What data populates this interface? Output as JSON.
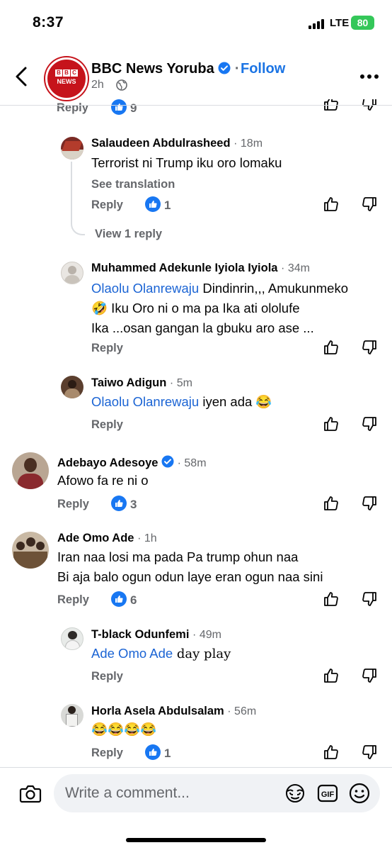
{
  "status_bar": {
    "time": "8:37",
    "network": "LTE",
    "battery": "80"
  },
  "header": {
    "page_name": "BBC News Yoruba",
    "follow_label": "Follow",
    "post_time": "2h",
    "avatar_text": "BBC NEWS"
  },
  "top_partial": {
    "reply": "Reply",
    "likes": "9"
  },
  "comments": [
    {
      "name": "Salaudeen Abdulrasheed",
      "time": "18m",
      "text": "Terrorist ni Trump iku oro lomaku",
      "see_translation": "See translation",
      "reply": "Reply",
      "likes": "1",
      "view_replies": "View 1 reply"
    },
    {
      "name": "Muhammed Adekunle Iyiola Iyiola",
      "time": "34m",
      "mention": "Olaolu Olanrewaju",
      "line1": " Dindinrin,,, Amukunmeko",
      "line2": "🤣 Iku Oro ni o ma pa Ika ati ololufe",
      "line3": "Ika ...osan gangan la gbuku aro ase ...",
      "reply": "Reply"
    },
    {
      "name": "Taiwo Adigun",
      "time": "5m",
      "mention": "Olaolu Olanrewaju",
      "text": " iyen ada 😂",
      "reply": "Reply"
    },
    {
      "name": "Adebayo Adesoye",
      "time": "58m",
      "text": "Afowo fa re ni o",
      "reply": "Reply",
      "likes": "3"
    },
    {
      "name": "Ade Omo Ade",
      "time": "1h",
      "line1": "Iran naa losi ma pada Pa trump ohun naa",
      "line2": "Bi aja balo ogun odun laye eran ogun naa sini",
      "reply": "Reply",
      "likes": "6"
    },
    {
      "name": "T-black Odunfemi",
      "time": "49m",
      "mention": "Ade Omo Ade",
      "text": " day play",
      "reply": "Reply"
    },
    {
      "name": "Horla Asela Abdulsalam",
      "time": "56m",
      "text": "😂😂😂😂",
      "reply": "Reply",
      "likes": "1"
    }
  ],
  "composer": {
    "placeholder": "Write a comment..."
  },
  "icons": {
    "like": "thumbs-up-icon",
    "dislike": "thumbs-down-icon",
    "camera": "camera-icon",
    "avatar_frame": "avatar-frame-icon",
    "gif": "gif-icon",
    "emoji": "emoji-icon"
  },
  "colors": {
    "accent": "#1b74e4",
    "bbc_red": "#c6131b",
    "like_blue": "#1877f2",
    "muted": "#65676b"
  }
}
